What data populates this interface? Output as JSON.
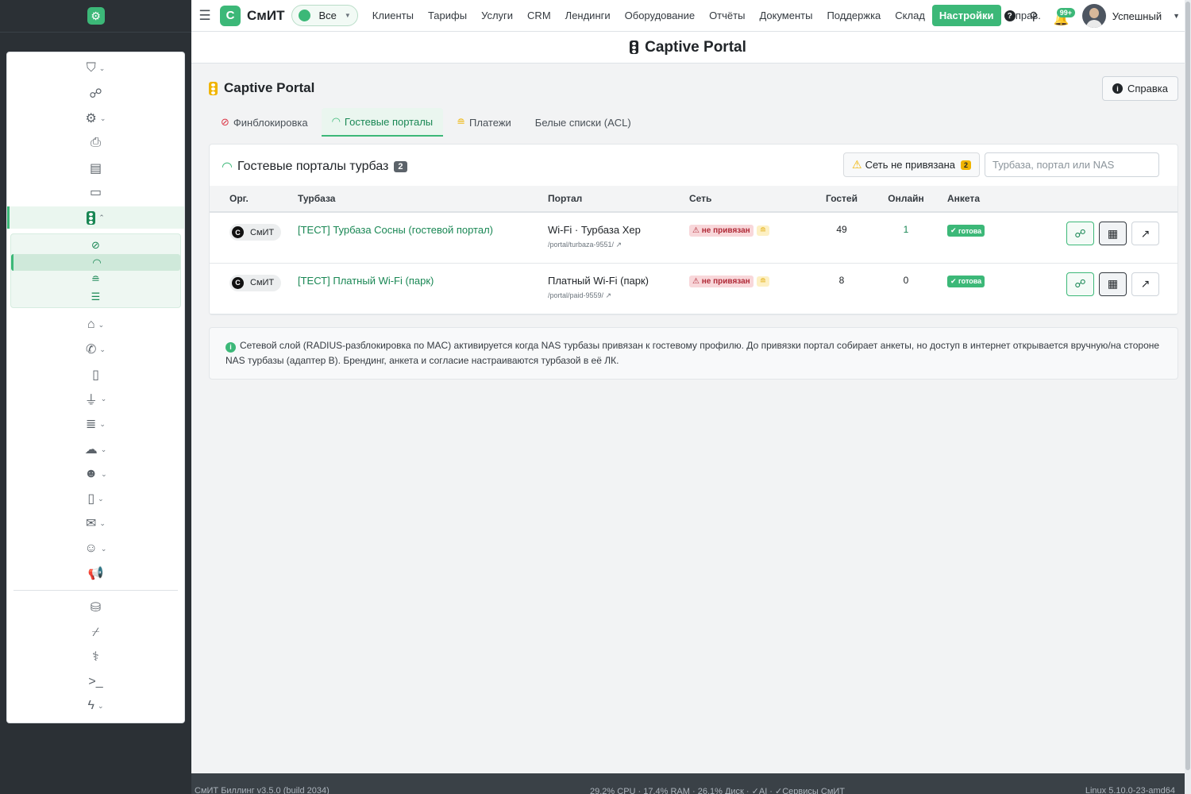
{
  "topnav": {
    "brand": "СмИТ",
    "brand_mark": "С",
    "scope": "Все",
    "links": [
      "Клиенты",
      "Тарифы",
      "Услуги",
      "CRM",
      "Лендинги",
      "Оборудование",
      "Отчёты",
      "Документы",
      "Поддержка",
      "Склад",
      "Настройки",
      "Справ."
    ],
    "active_link": "Настройки",
    "notifications": "99+",
    "username": "Успешный"
  },
  "page": {
    "header": "Captive Portal",
    "section_title": "Captive Portal",
    "help_button": "Справка"
  },
  "tabs": [
    {
      "label": "Финблокировка",
      "icon": "ban-icon"
    },
    {
      "label": "Гостевые порталы",
      "icon": "wifi-icon",
      "active": true
    },
    {
      "label": "Платежи",
      "icon": "coins-icon"
    },
    {
      "label": "Белые списки (ACL)",
      "icon": ""
    }
  ],
  "card": {
    "title": "Гостевые порталы турбаз",
    "count": "2",
    "warn_label": "Сеть не привязана",
    "warn_count": "2",
    "search_placeholder": "Турбаза, портал или NAS"
  },
  "table": {
    "columns": [
      "Орг.",
      "Турбаза",
      "Портал",
      "Сеть",
      "Гостей",
      "Онлайн",
      "Анкета",
      ""
    ],
    "rows": [
      {
        "org": "СмИТ",
        "base": "[ТЕСТ] Турбаза Сосны (гостевой портал)",
        "portal": "Wi-Fi · Турбаза Хер",
        "path": "/portal/turbaza-9551/ ↗",
        "net": "не привязан",
        "guests": "49",
        "online": "1",
        "form": "готова"
      },
      {
        "org": "СмИТ",
        "base": "[ТЕСТ] Платный Wi-Fi (парк)",
        "portal": "Платный Wi-Fi (парк)",
        "path": "/portal/paid-9559/ ↗",
        "net": "не привязан",
        "guests": "8",
        "online": "0",
        "form": "готова"
      }
    ]
  },
  "info_text": "Сетевой слой (RADIUS-разблокировка по MAC) активируется когда NAS турбазы привязан к гостевому профилю. До привязки портал собирает анкеты, но доступ в интернет открывается вручную/на стороне NAS турбазы (адаптер B). Брендинг, анкета и согласие настраиваются турбазой в её ЛК.",
  "footer": {
    "left": "СмИТ Биллинг v3.5.0 (build 2034)",
    "center": "29.2% CPU · 17.4% RAM · 26.1% Диск · ✓AI · ✓Сервисы СмИТ",
    "right": "Linux 5.10.0-23-amd64"
  },
  "colors": {
    "accent": "#3cb878",
    "danger": "#dc3545",
    "warning": "#f0b400"
  }
}
